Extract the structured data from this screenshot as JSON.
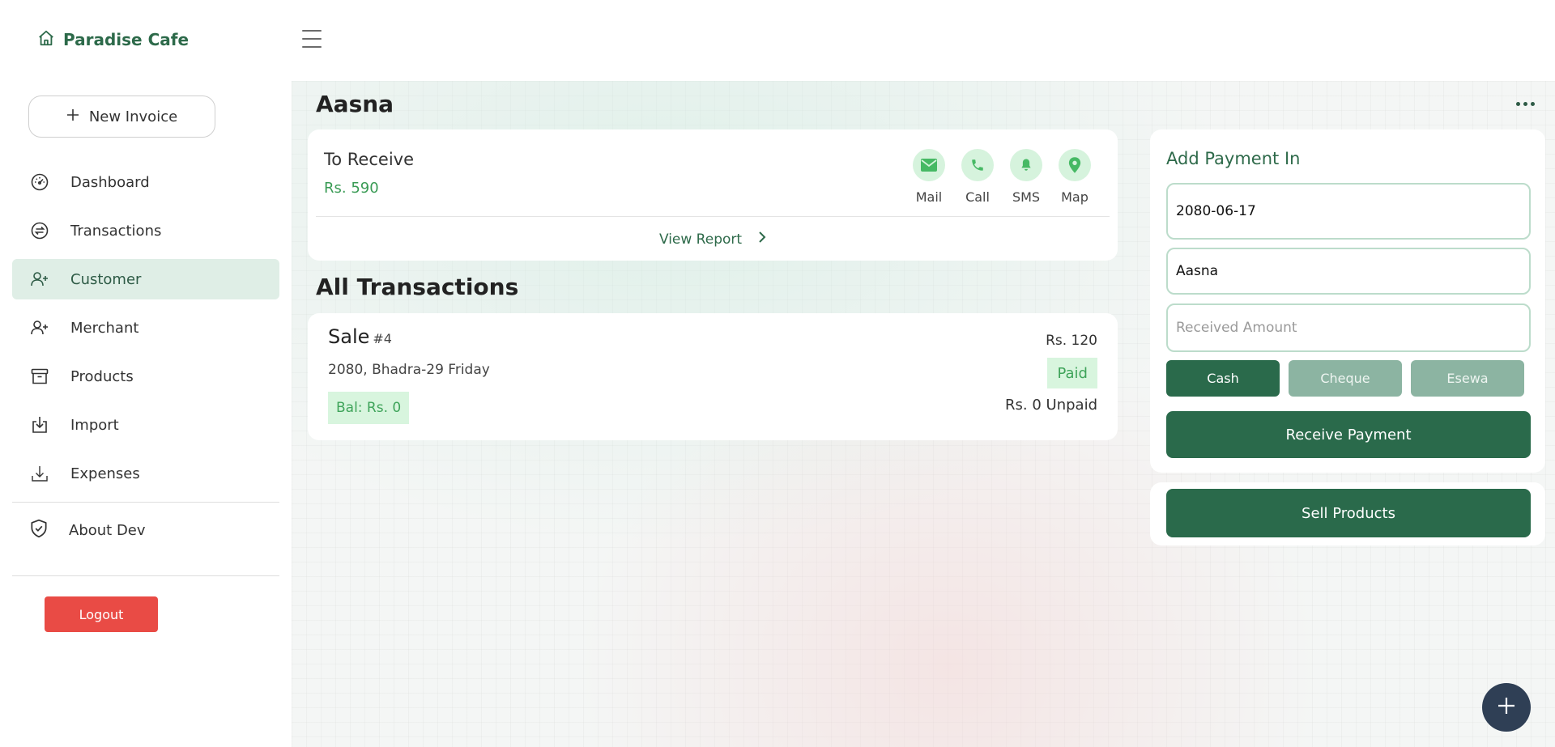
{
  "brand": {
    "name": "Paradise Cafe",
    "icon": "home-icon"
  },
  "sidebar": {
    "new_invoice_label": "New Invoice",
    "items": [
      {
        "label": "Dashboard",
        "icon": "gauge-icon"
      },
      {
        "label": "Transactions",
        "icon": "transfer-icon"
      },
      {
        "label": "Customer",
        "icon": "user-plus-icon",
        "active": true
      },
      {
        "label": "Merchant",
        "icon": "user-plus-icon"
      },
      {
        "label": "Products",
        "icon": "archive-icon"
      },
      {
        "label": "Import",
        "icon": "import-icon"
      },
      {
        "label": "Expenses",
        "icon": "download-icon"
      }
    ],
    "about_label": "About Dev",
    "logout_label": "Logout"
  },
  "page": {
    "title": "Aasna",
    "to_receive_label": "To Receive",
    "to_receive_amount": "Rs. 590",
    "contact_actions": [
      {
        "label": "Mail",
        "icon": "mail-icon"
      },
      {
        "label": "Call",
        "icon": "phone-icon"
      },
      {
        "label": "SMS",
        "icon": "bell-icon"
      },
      {
        "label": "Map",
        "icon": "map-pin-icon"
      }
    ],
    "view_report_label": "View Report",
    "all_transactions_title": "All Transactions",
    "transactions": [
      {
        "type": "Sale",
        "number": "#4",
        "date": "2080, Bhadra-29 Friday",
        "balance": "Bal: Rs. 0",
        "amount": "Rs. 120",
        "status": "Paid",
        "unpaid": "Rs. 0 Unpaid"
      }
    ]
  },
  "payment": {
    "title": "Add Payment In",
    "date_value": "2080-06-17",
    "customer_value": "Aasna",
    "amount_placeholder": "Received Amount",
    "methods": [
      "Cash",
      "Cheque",
      "Esewa"
    ],
    "selected_method": "Cash",
    "receive_label": "Receive Payment",
    "sell_label": "Sell Products"
  },
  "colors": {
    "primary": "#2a6a4b",
    "accent_green": "#3a9b55",
    "logout_red": "#e94b45",
    "fab": "#2f3f55"
  }
}
